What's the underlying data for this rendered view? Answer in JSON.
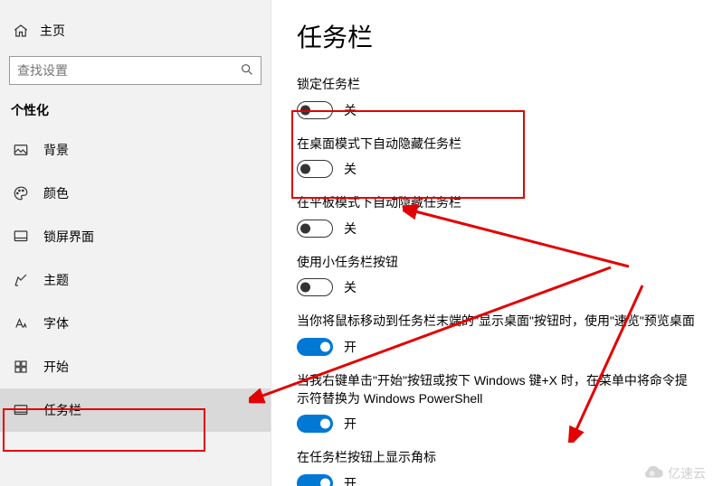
{
  "sidebar": {
    "home_label": "主页",
    "search_placeholder": "查找设置",
    "section_title": "个性化",
    "items": [
      {
        "label": "背景"
      },
      {
        "label": "颜色"
      },
      {
        "label": "锁屏界面"
      },
      {
        "label": "主题"
      },
      {
        "label": "字体"
      },
      {
        "label": "开始"
      },
      {
        "label": "任务栏"
      }
    ]
  },
  "main": {
    "title": "任务栏",
    "settings": [
      {
        "label": "锁定任务栏",
        "on": false
      },
      {
        "label": "在桌面模式下自动隐藏任务栏",
        "on": false
      },
      {
        "label": "在平板模式下自动隐藏任务栏",
        "on": false
      },
      {
        "label": "使用小任务栏按钮",
        "on": false
      },
      {
        "label": "当你将鼠标移动到任务栏末端的\"显示桌面\"按钮时，使用\"速览\"预览桌面",
        "on": true
      },
      {
        "label": "当我右键单击\"开始\"按钮或按下 Windows 键+X 时，在菜单中将命令提示符替换为 Windows PowerShell",
        "on": true
      },
      {
        "label": "在任务栏按钮上显示角标",
        "on": true
      }
    ],
    "state_on": "开",
    "state_off": "关"
  },
  "watermark": "亿速云"
}
